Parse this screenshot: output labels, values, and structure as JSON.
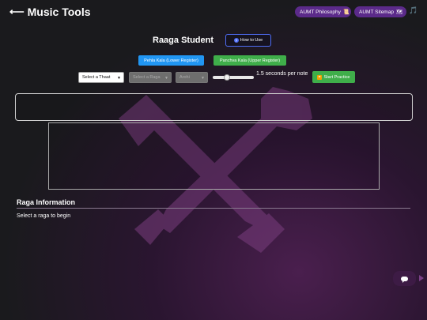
{
  "header": {
    "back_arrow": "⟵",
    "title": "Music Tools",
    "philosophy_label": "AUMT Philosophy",
    "philosophy_icon": "📜",
    "sitemap_label": "AUMT Sitemap",
    "sitemap_icon": "🗺",
    "music_icon": "🎵"
  },
  "main": {
    "title": "Raaga Student",
    "howto_label": "How to Use",
    "howto_icon": "?",
    "lower_register_label": "Pehla Kala (Lower Register)",
    "upper_register_label": "Panchva Kala (Upper Register)"
  },
  "controls": {
    "thaat_value": "Select a Thaat",
    "raga_value": "Select a Raga",
    "arohi_value": "Arohi",
    "speed_fraction": 0.35,
    "speed_label": "1.5 seconds per note",
    "start_label": "Start Practice"
  },
  "info": {
    "heading": "Raga Information",
    "text": "Select a raga to begin"
  },
  "colors": {
    "pill": "#5b2a8a",
    "lower_register": "#2196f3",
    "upper_register": "#3fae4a",
    "howto_border": "#4f6ef7"
  }
}
